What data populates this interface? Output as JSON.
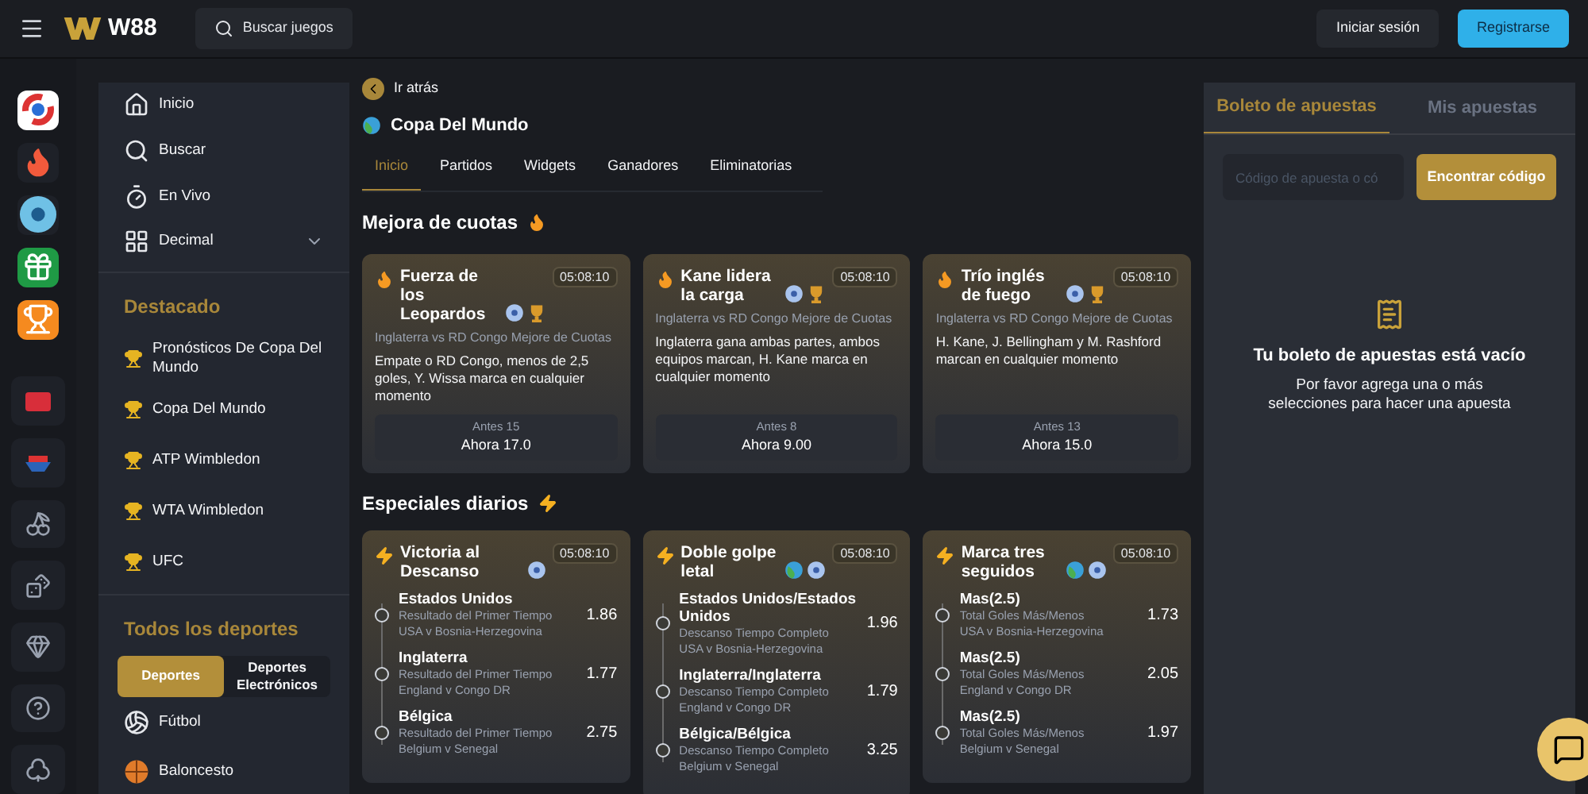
{
  "header": {
    "brand": "W88",
    "search": "Buscar juegos",
    "login": "Iniciar sesión",
    "register": "Registrarse"
  },
  "nav": {
    "items": [
      {
        "label": "Inicio",
        "kind": "home"
      },
      {
        "label": "Buscar",
        "kind": "search"
      },
      {
        "label": "En Vivo",
        "kind": "live"
      },
      {
        "label": "Decimal",
        "kind": "odds"
      }
    ],
    "featured_title": "Destacado",
    "featured": [
      "Pronósticos De Copa Del Mundo",
      "Copa Del Mundo",
      "ATP Wimbledon",
      "WTA Wimbledon",
      "UFC"
    ],
    "sports_title": "Todos los deportes",
    "toggle": [
      {
        "label": "Deportes",
        "selected": true
      },
      {
        "label": "Deportes Electrónicos",
        "selected": false
      }
    ],
    "sports": [
      {
        "label": "Fútbol",
        "kind": "football"
      },
      {
        "label": "Baloncesto",
        "kind": "basketball"
      }
    ]
  },
  "main": {
    "back": "Ir atrás",
    "title": "Copa Del Mundo",
    "tabs": [
      {
        "label": "Inicio",
        "selected": true
      },
      {
        "label": "Partidos",
        "selected": false
      },
      {
        "label": "Widgets",
        "selected": false
      },
      {
        "label": "Ganadores",
        "selected": false
      },
      {
        "label": "Eliminatorias",
        "selected": false
      }
    ],
    "boost_title": "Mejora de cuotas",
    "boosts": [
      {
        "title": "Fuerza de los Leopardos",
        "time": "05:08:10",
        "subtitle": "Inglaterra vs RD Congo Mejore de Cuotas",
        "description": "Empate o RD Congo, menos de 2,5 goles, Y. Wissa marca en cualquier momento",
        "before": "Antes 15",
        "now": "Ahora 17.0"
      },
      {
        "title": "Kane lidera la carga",
        "time": "05:08:10",
        "subtitle": "Inglaterra vs RD Congo Mejore de Cuotas",
        "description": "Inglaterra gana ambas partes, ambos equipos marcan, H. Kane marca en cualquier momento",
        "before": "Antes 8",
        "now": "Ahora 9.00"
      },
      {
        "title": "Trío inglés de fuego",
        "time": "05:08:10",
        "subtitle": "Inglaterra vs RD Congo Mejore de Cuotas",
        "description": "H. Kane, J. Bellingham y M. Rashford marcan en cualquier momento",
        "before": "Antes 13",
        "now": "Ahora 15.0"
      }
    ],
    "specials_title": "Especiales diarios",
    "specials": [
      {
        "title": "Victoria al Descanso",
        "time": "05:08:10",
        "legs": [
          {
            "pick": "Estados Unidos",
            "market": "Resultado del Primer Tiempo",
            "match": "USA v Bosnia-Herzegovina",
            "odds": "1.86"
          },
          {
            "pick": "Inglaterra",
            "market": "Resultado del Primer Tiempo",
            "match": "England v Congo DR",
            "odds": "1.77"
          },
          {
            "pick": "Bélgica",
            "market": "Resultado del Primer Tiempo",
            "match": "Belgium v Senegal",
            "odds": "2.75"
          }
        ]
      },
      {
        "title": "Doble golpe letal",
        "time": "05:08:10",
        "legs": [
          {
            "pick": "Estados Unidos/Estados Unidos",
            "market": "Descanso Tiempo Completo",
            "match": "USA v Bosnia-Herzegovina",
            "odds": "1.96"
          },
          {
            "pick": "Inglaterra/Inglaterra",
            "market": "Descanso Tiempo Completo",
            "match": "England v Congo DR",
            "odds": "1.79"
          },
          {
            "pick": "Bélgica/Bélgica",
            "market": "Descanso Tiempo Completo",
            "match": "Belgium v Senegal",
            "odds": "3.25"
          }
        ]
      },
      {
        "title": "Marca tres seguidos",
        "time": "05:08:10",
        "legs": [
          {
            "pick": "Mas(2.5)",
            "market": "Total Goles Más/Menos",
            "match": "USA v Bosnia-Herzegovina",
            "odds": "1.73"
          },
          {
            "pick": "Mas(2.5)",
            "market": "Total Goles Más/Menos",
            "match": "England v Congo DR",
            "odds": "2.05"
          },
          {
            "pick": "Mas(2.5)",
            "market": "Total Goles Más/Menos",
            "match": "Belgium v Senegal",
            "odds": "1.97"
          }
        ]
      }
    ]
  },
  "betslip": {
    "tabs": [
      {
        "label": "Boleto de apuestas",
        "selected": true
      },
      {
        "label": "Mis apuestas",
        "selected": false
      }
    ],
    "code_placeholder": "Código de apuesta o có",
    "find": "Encontrar código",
    "empty_title": "Tu boleto de apuestas está vacío",
    "empty_text": "Por favor agrega una o más selecciones para hacer una apuesta"
  }
}
